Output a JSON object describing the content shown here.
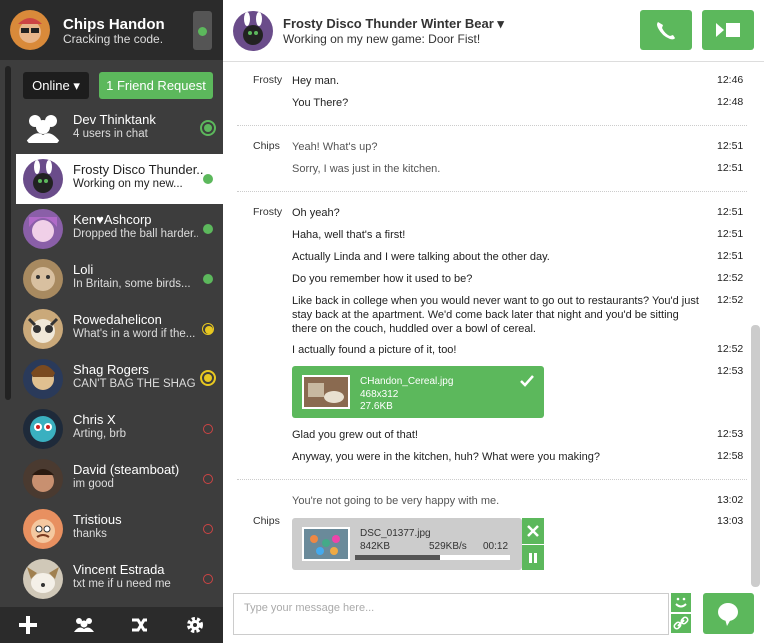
{
  "me": {
    "name": "Chips Handon",
    "status": "Cracking the code."
  },
  "sidebar": {
    "online_label": "Online ▾",
    "friend_request_label": "1 Friend Request",
    "contacts": [
      {
        "name": "Dev Thinktank",
        "status": "4 users in chat",
        "presence": "online-group"
      },
      {
        "name": "Frosty Disco Thunder...",
        "status": "Working on my new...",
        "presence": "online"
      },
      {
        "name": "Ken♥Ashcorp",
        "status": "Dropped the ball harder...",
        "presence": "online"
      },
      {
        "name": "Loli",
        "status": "In Britain, some birds...",
        "presence": "online"
      },
      {
        "name": "Rowedahelicon",
        "status": "What's in a word if the...",
        "presence": "away"
      },
      {
        "name": "Shag Rogers",
        "status": "CAN'T BAG THE SHAG",
        "presence": "away-ring"
      },
      {
        "name": "Chris X",
        "status": "Arting, brb",
        "presence": "offline"
      },
      {
        "name": "David (steamboat)",
        "status": "im good",
        "presence": "offline"
      },
      {
        "name": "Tristious",
        "status": "thanks",
        "presence": "offline"
      },
      {
        "name": "Vincent Estrada",
        "status": "txt me if u need me",
        "presence": "offline"
      }
    ]
  },
  "header": {
    "name": "Frosty Disco Thunder Winter Bear ▾",
    "status": "Working on my new game: Door Fist!"
  },
  "messages": [
    {
      "sender": "Frosty",
      "text": "Hey man.",
      "time": "12:46"
    },
    {
      "sender": "",
      "text": "You There?",
      "time": "12:48"
    },
    {
      "sender": "Chips",
      "text": "Yeah! What's up?",
      "time": "12:51"
    },
    {
      "sender": "",
      "text": "Sorry, I was just in the kitchen.",
      "time": "12:51"
    },
    {
      "sender": "Frosty",
      "text": "Oh yeah?",
      "time": "12:51"
    },
    {
      "sender": "",
      "text": "Haha, well that's a first!",
      "time": "12:51"
    },
    {
      "sender": "",
      "text": "Actually Linda and I were talking about the other day.",
      "time": "12:51"
    },
    {
      "sender": "",
      "text": "Do you remember how it used to be?",
      "time": "12:52"
    },
    {
      "sender": "",
      "text": "Like back in college when you would never want to go out to restaurants? You'd just stay back at the apartment. We'd come back later that night and you'd be sitting there on the couch, huddled over a bowl of cereal.",
      "time": "12:52"
    },
    {
      "sender": "",
      "text": "I actually found a picture of it, too!",
      "time": "12:52"
    },
    {
      "sender": "",
      "text": "",
      "time": "12:53"
    },
    {
      "sender": "",
      "text": "Glad you grew out of that!",
      "time": "12:53"
    },
    {
      "sender": "",
      "text": "Anyway, you were in the kitchen, huh? What were you making?",
      "time": "12:58"
    },
    {
      "sender": "",
      "text": "You're not going to be very happy with me.",
      "time": "13:02"
    },
    {
      "sender": "Chips",
      "text": "",
      "time": "13:03"
    }
  ],
  "file_sent": {
    "name": "CHandon_Cereal.jpg",
    "dims": "468x312",
    "size": "27.6KB"
  },
  "file_upload": {
    "name": "DSC_01377.jpg",
    "size": "842KB",
    "speed": "529KB/s",
    "eta": "00:12",
    "progress": 0.55
  },
  "input": {
    "placeholder": "Type your message here..."
  },
  "colors": {
    "accent": "#5cb85c",
    "sidebar": "#3d3d3d",
    "away": "#e8c820",
    "offline": "#cc4444"
  },
  "icons": [
    "plus-icon",
    "users-icon",
    "shuffle-icon",
    "gear-icon",
    "phone-icon",
    "video-icon",
    "smile-icon",
    "link-icon",
    "chat-bubble-icon",
    "check-icon",
    "close-icon",
    "pause-icon"
  ]
}
